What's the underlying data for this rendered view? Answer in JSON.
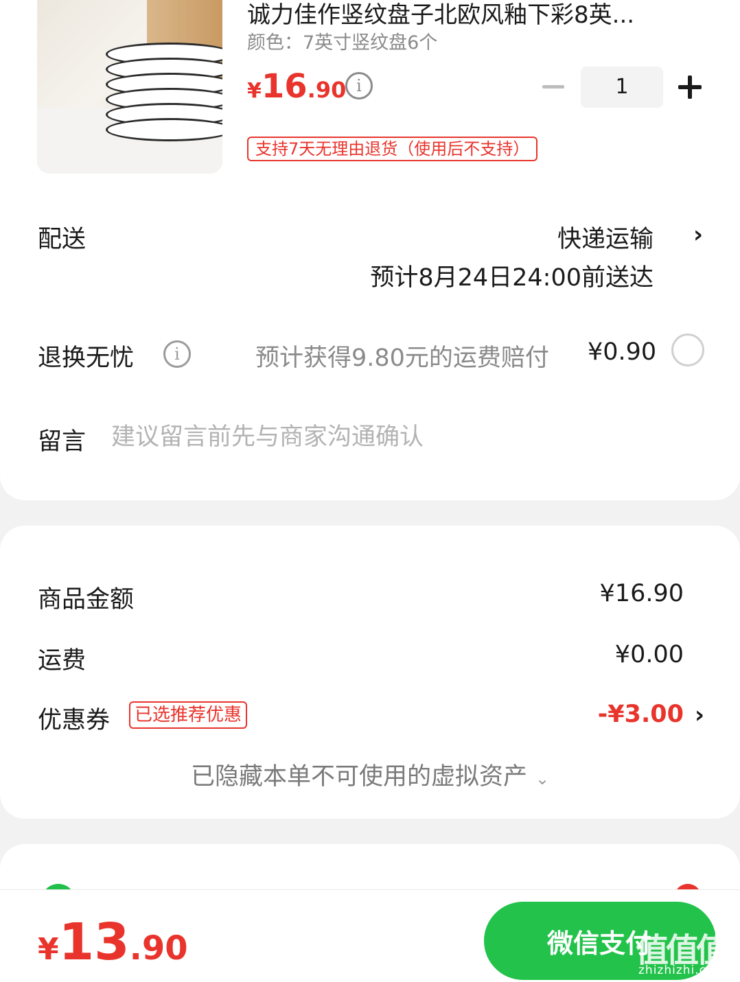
{
  "product": {
    "title": "诚力佳作竖纹盘子北欧风釉下彩8英...",
    "variant": "颜色：7英寸竖纹盘6个",
    "price_symbol": "¥",
    "price_int": "16",
    "price_dec": ".90",
    "info_icon": "i",
    "quantity": "1",
    "return_policy": "支持7天无理由退货（使用后不支持）"
  },
  "delivery": {
    "label": "配送",
    "method": "快递运输",
    "eta": "预计8月24日24:00前送达",
    "chevron": "›"
  },
  "return_service": {
    "label": "退换无忧",
    "info_icon": "i",
    "description": "预计获得9.80元的运费赔付",
    "price": "¥0.90"
  },
  "note": {
    "label": "留言",
    "placeholder": "建议留言前先与商家沟通确认"
  },
  "summary": {
    "goods_label": "商品金额",
    "goods_value": "¥16.90",
    "shipping_label": "运费",
    "shipping_value": "¥0.00",
    "coupon_label": "优惠券",
    "coupon_badge": "已选推荐优惠",
    "coupon_value": "-¥3.00",
    "coupon_chevron": "›",
    "hidden_assets": "已隐藏本单不可使用的虚拟资产",
    "hidden_chevron": "⌄"
  },
  "footer": {
    "total_symbol": "¥",
    "total_int": "13",
    "total_dec": ".90",
    "pay_button": "微信支付"
  },
  "watermark": {
    "text": "值值值",
    "url": "zhizhizhi.com"
  },
  "colors": {
    "accent_red": "#e8342c",
    "wechat_green": "#22c24b"
  }
}
